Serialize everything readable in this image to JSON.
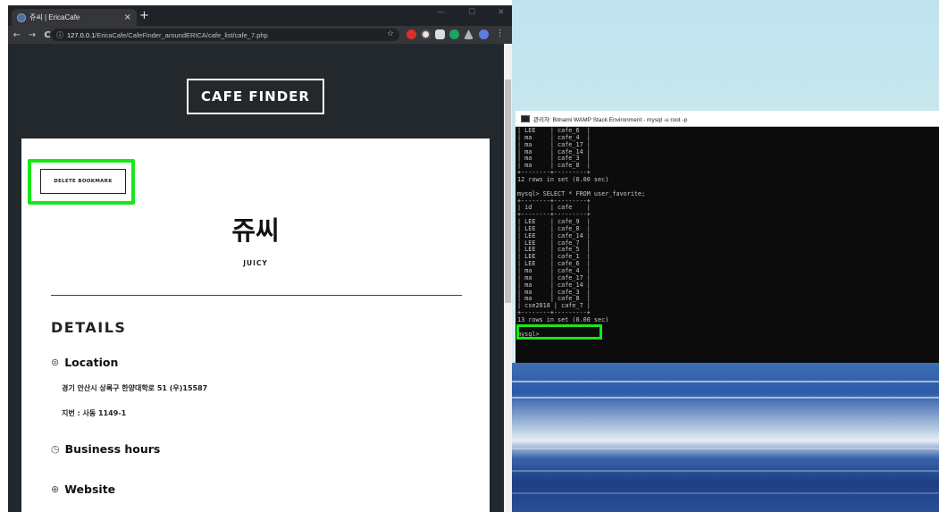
{
  "browser": {
    "tab_title": "쥬씨 | EricaCafe",
    "tab_close": "×",
    "new_tab": "+",
    "url_host": "127.0.0.1",
    "url_path": "/EricaCafe/CafeFinder_aroundERICA/cafe_list/cafe_7.php",
    "nav_back": "←",
    "nav_forward": "→",
    "nav_reload": "C",
    "info_icon": "ⓘ",
    "star": "☆",
    "win_min": "—",
    "win_max": "☐",
    "win_close": "✕"
  },
  "site": {
    "logo": "CAFE FINDER",
    "bookmark_button": "DELETE BOOKMARK",
    "cafe_name_kr": "쥬씨",
    "cafe_name_en": "JUICY",
    "details_heading": "DETAILS",
    "location_label": "Location",
    "address": "경기 안산시 상록구 한양대학로 51 (우)15587",
    "lot_address": "지번 : 사동 1149-1",
    "hours_label": "Business hours",
    "website_label": "Website"
  },
  "terminal": {
    "title": "관리자: Bitnami WAMP Stack Environment - mysql  -u root -p",
    "lines": [
      "| LEE    | cafe_6  |",
      "| ma     | cafe_4  |",
      "| ma     | cafe_17 |",
      "| ma     | cafe_14 |",
      "| ma     | cafe_3  |",
      "| ma     | cafe_8  |",
      "+--------+---------+",
      "12 rows in set (0.00 sec)",
      "",
      "mysql> SELECT * FROM user_favorite;",
      "+--------+---------+",
      "| id     | cafe    |",
      "+--------+---------+",
      "| LEE    | cafe_9  |",
      "| LEE    | cafe_0  |",
      "| LEE    | cafe_14 |",
      "| LEE    | cafe_7  |",
      "| LEE    | cafe_5  |",
      "| LEE    | cafe_1  |",
      "| LEE    | cafe_6  |",
      "| ma     | cafe_4  |",
      "| ma     | cafe_17 |",
      "| ma     | cafe_14 |",
      "| ma     | cafe_3  |",
      "| ma     | cafe_8  |",
      "| cse2018 | cafe_7 |",
      "+--------+---------+",
      "13 rows in set (0.00 sec)",
      "",
      "mysql>"
    ]
  },
  "colors": {
    "highlight": "#19e619",
    "page_dark": "#23282d"
  }
}
